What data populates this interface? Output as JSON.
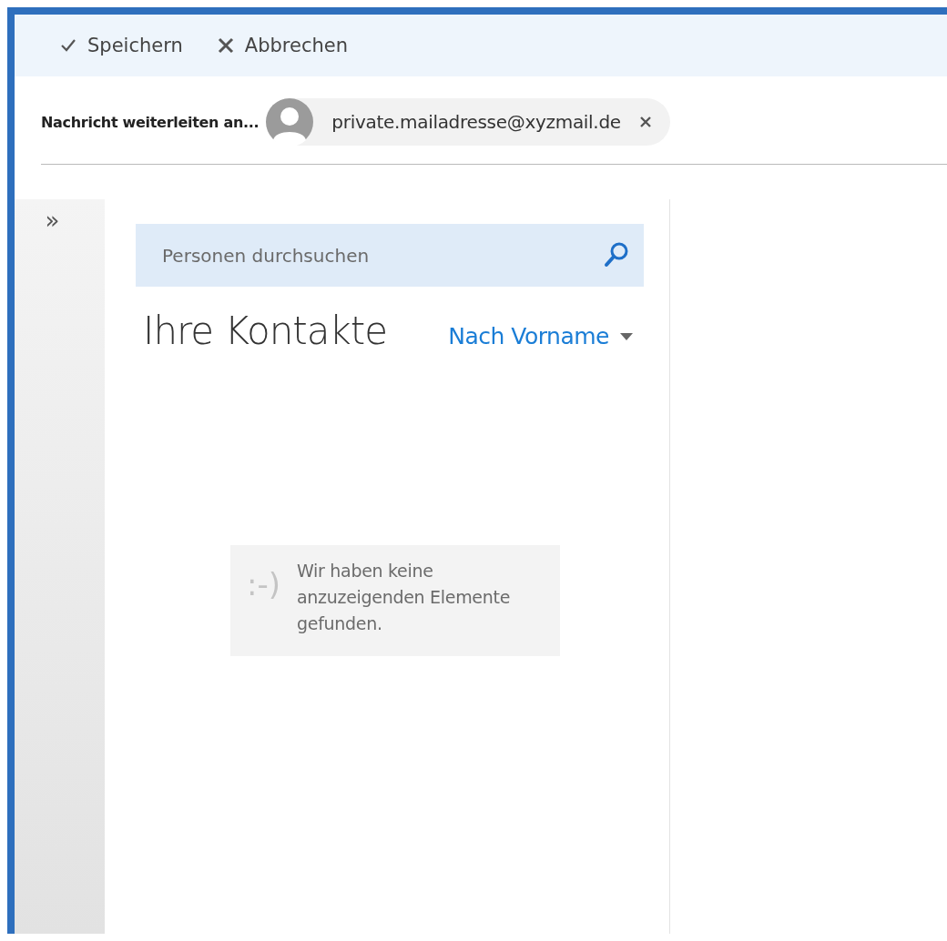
{
  "toolbar": {
    "buttons": [
      {
        "kind": "save",
        "label": "Speichern"
      },
      {
        "kind": "cancel",
        "label": "Abbrechen"
      }
    ]
  },
  "forward": {
    "label": "Nachricht weiterleiten an...",
    "recipient": "private.mailadresse@xyzmail.de"
  },
  "sidebar": {
    "expand_glyph": "»"
  },
  "search": {
    "placeholder": "Personen durchsuchen"
  },
  "contacts": {
    "title": "Ihre Kontakte",
    "sort": "Nach Vorname"
  },
  "empty": {
    "emoticon": ":-)",
    "message": "Wir haben keine anzuzeigenden Elemente gefunden."
  }
}
